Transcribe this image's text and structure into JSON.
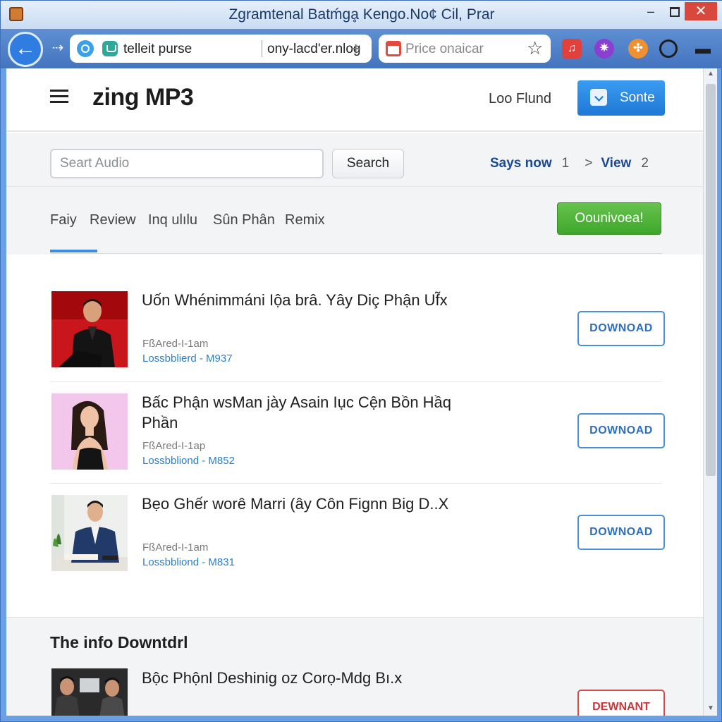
{
  "window": {
    "title": "Zgramtenal Batḿgḁ Kengo.No¢ Cil, Prar",
    "minimize": "–",
    "close": "✕"
  },
  "toolbar": {
    "back": "←",
    "forward": "⇢",
    "url_domain": "telleit purse",
    "url_path": "ony-lacd'er.nlog",
    "url_add": "+",
    "search_placeholder": "Price onaicar",
    "star": "☆",
    "ext_music": "♫",
    "ext_gem": "✷",
    "ext_gear": "✣",
    "ext_menu": "▬"
  },
  "header": {
    "logo": "zing MP3",
    "login": "Loo Flund",
    "signup": "Sonte"
  },
  "search": {
    "placeholder": "Seart Audio",
    "button": "Search",
    "pager_link1": "Says now",
    "pager_num1": "1",
    "pager_arrow": ">",
    "pager_link2": "View",
    "pager_num2": "2"
  },
  "tabs": {
    "items": [
      "Faiy",
      "Review",
      "Inq ulılu",
      "Sûn Phân",
      "Remix"
    ],
    "download_all": "Oounivoea!"
  },
  "songs": [
    {
      "title": "Uốn Whénimmáni Iộa brâ. Yây Diç Phận Uf̃x",
      "meta": "FßAred-I-1am",
      "sub": "Lossbblierd - M937",
      "button": "DOWNOAD"
    },
    {
      "title": "Bấc Phận wsMan jày Asain Iục Cện Bồn Hầq Phần",
      "meta": "FßAred-I-1ap",
      "sub": "Lossbbliond - M852",
      "button": "DOWNOAD"
    },
    {
      "title": "Bẹo Ghếr worê Marri (ây Côn Fignn Big D..X",
      "meta": "FßAred-I-1am",
      "sub": "Lossbbliond - M831",
      "button": "DOWNOAD"
    }
  ],
  "info": {
    "title": "The info Downtdrl",
    "song_title": "Bộc Phộnl Deshinig oz Corọ-Mdg Bı.x",
    "button": "DEWNANT"
  },
  "colors": {
    "accent_blue": "#1f78d6",
    "download_green": "#3ea62b",
    "download_outline": "#4a90d8",
    "download_red": "#d44b4b"
  }
}
